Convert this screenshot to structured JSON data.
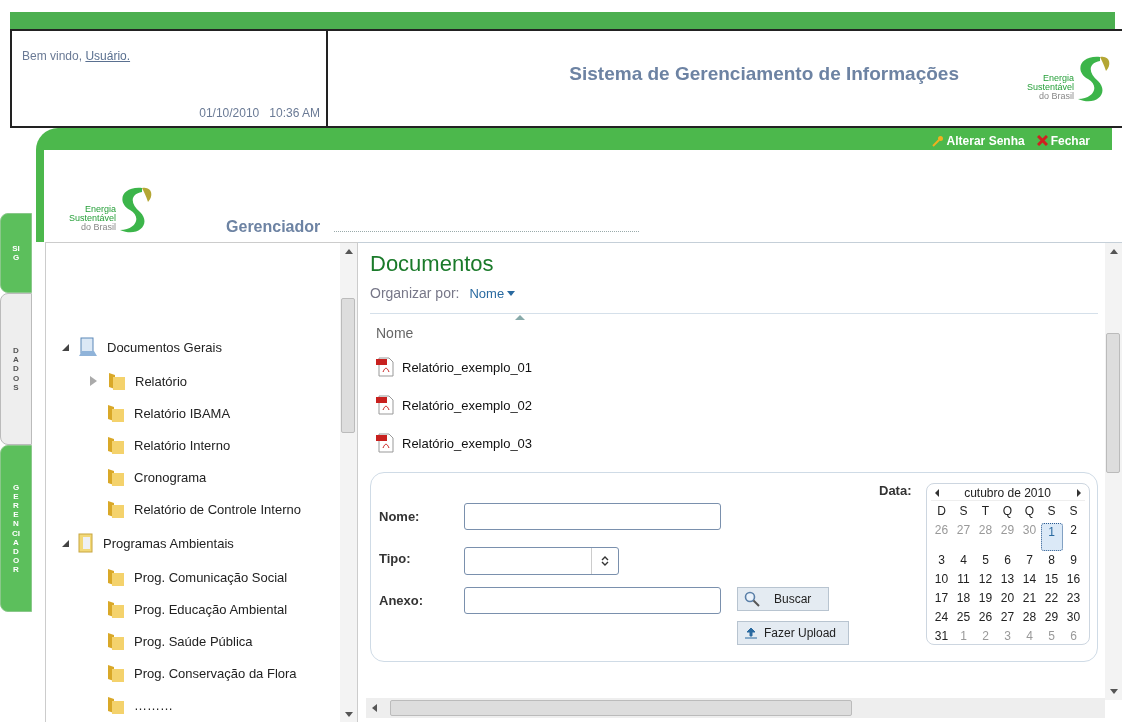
{
  "header": {
    "greeting": "Bem vindo,",
    "user_link": "Usuário.",
    "date": "01/10/2010",
    "time": "10:36 AM",
    "title": "Sistema de Gerenciamento de Informações",
    "logo": [
      "Energia",
      "Sustentável",
      "do Brasil"
    ]
  },
  "side_tabs": [
    {
      "label": "SIG",
      "selected": false
    },
    {
      "label": "DADOS",
      "selected": true
    },
    {
      "label": "GERENCIADOR",
      "selected": false
    }
  ],
  "top_links": [
    "Alterar Senha",
    "Fechar"
  ],
  "brand": {
    "logo": [
      "Energia",
      "Sustentável",
      "do Brasil"
    ],
    "section": "Gerenciador"
  },
  "tree": [
    {
      "label": "Documentos Gerais",
      "kind": "drive",
      "expanded": true,
      "children": [
        {
          "label": "Relatório",
          "kind": "folder",
          "expanded": false
        },
        {
          "label": "Relatório IBAMA",
          "kind": "folder"
        },
        {
          "label": "Relatório Interno",
          "kind": "folder"
        },
        {
          "label": "Cronograma",
          "kind": "folder"
        },
        {
          "label": "Relatório de Controle Interno",
          "kind": "folder"
        }
      ]
    },
    {
      "label": "Programas Ambientais",
      "kind": "binder",
      "expanded": true,
      "children": [
        {
          "label": "Prog. Comunicação Social",
          "kind": "folder"
        },
        {
          "label": "Prog. Educação Ambiental",
          "kind": "folder"
        },
        {
          "label": "Prog. Saúde Pública",
          "kind": "folder"
        },
        {
          "label": "Prog. Conservação da Flora",
          "kind": "folder"
        },
        {
          "label": "………",
          "kind": "folder"
        }
      ]
    }
  ],
  "documents": {
    "title": "Documentos",
    "organize_label": "Organizar por:",
    "organize_value": "Nome",
    "column": "Nome",
    "files": [
      "Relatório_exemplo_01",
      "Relatório_exemplo_02",
      "Relatório_exemplo_03"
    ]
  },
  "form": {
    "name_label": "Nome:",
    "type_label": "Tipo:",
    "attachment_label": "Anexo:",
    "search_button": "Buscar",
    "upload_button": "Fazer Upload",
    "date_label": "Data:"
  },
  "calendar": {
    "month": "cutubro de 2010",
    "weekdays": [
      "D",
      "S",
      "T",
      "Q",
      "Q",
      "S",
      "S"
    ],
    "weeks": [
      [
        {
          "d": "26",
          "muted": true,
          "selected": false
        },
        {
          "d": "27",
          "muted": true,
          "selected": false
        },
        {
          "d": "28",
          "muted": true,
          "selected": false
        },
        {
          "d": "29",
          "muted": true,
          "selected": false
        },
        {
          "d": "30",
          "muted": true,
          "selected": false
        },
        {
          "d": "1",
          "muted": false,
          "selected": true
        },
        {
          "d": "2",
          "muted": false,
          "selected": false
        }
      ],
      [
        {
          "d": "3",
          "muted": false,
          "selected": false
        },
        {
          "d": "4",
          "muted": false,
          "selected": false
        },
        {
          "d": "5",
          "muted": false,
          "selected": false
        },
        {
          "d": "6",
          "muted": false,
          "selected": false
        },
        {
          "d": "7",
          "muted": false,
          "selected": false
        },
        {
          "d": "8",
          "muted": false,
          "selected": false
        },
        {
          "d": "9",
          "muted": false,
          "selected": false
        }
      ],
      [
        {
          "d": "10",
          "muted": false,
          "selected": false
        },
        {
          "d": "11",
          "muted": false,
          "selected": false
        },
        {
          "d": "12",
          "muted": false,
          "selected": false
        },
        {
          "d": "13",
          "muted": false,
          "selected": false
        },
        {
          "d": "14",
          "muted": false,
          "selected": false
        },
        {
          "d": "15",
          "muted": false,
          "selected": false
        },
        {
          "d": "16",
          "muted": false,
          "selected": false
        }
      ],
      [
        {
          "d": "17",
          "muted": false,
          "selected": false
        },
        {
          "d": "18",
          "muted": false,
          "selected": false
        },
        {
          "d": "19",
          "muted": false,
          "selected": false
        },
        {
          "d": "20",
          "muted": false,
          "selected": false
        },
        {
          "d": "21",
          "muted": false,
          "selected": false
        },
        {
          "d": "22",
          "muted": false,
          "selected": false
        },
        {
          "d": "23",
          "muted": false,
          "selected": false
        }
      ],
      [
        {
          "d": "24",
          "muted": false,
          "selected": false
        },
        {
          "d": "25",
          "muted": false,
          "selected": false
        },
        {
          "d": "26",
          "muted": false,
          "selected": false
        },
        {
          "d": "27",
          "muted": false,
          "selected": false
        },
        {
          "d": "28",
          "muted": false,
          "selected": false
        },
        {
          "d": "29",
          "muted": false,
          "selected": false
        },
        {
          "d": "30",
          "muted": false,
          "selected": false
        }
      ],
      [
        {
          "d": "31",
          "muted": false,
          "selected": false
        },
        {
          "d": "1",
          "muted": true,
          "selected": false
        },
        {
          "d": "2",
          "muted": true,
          "selected": false
        },
        {
          "d": "3",
          "muted": true,
          "selected": false
        },
        {
          "d": "4",
          "muted": true,
          "selected": false
        },
        {
          "d": "5",
          "muted": true,
          "selected": false
        },
        {
          "d": "6",
          "muted": true,
          "selected": false
        }
      ]
    ]
  }
}
